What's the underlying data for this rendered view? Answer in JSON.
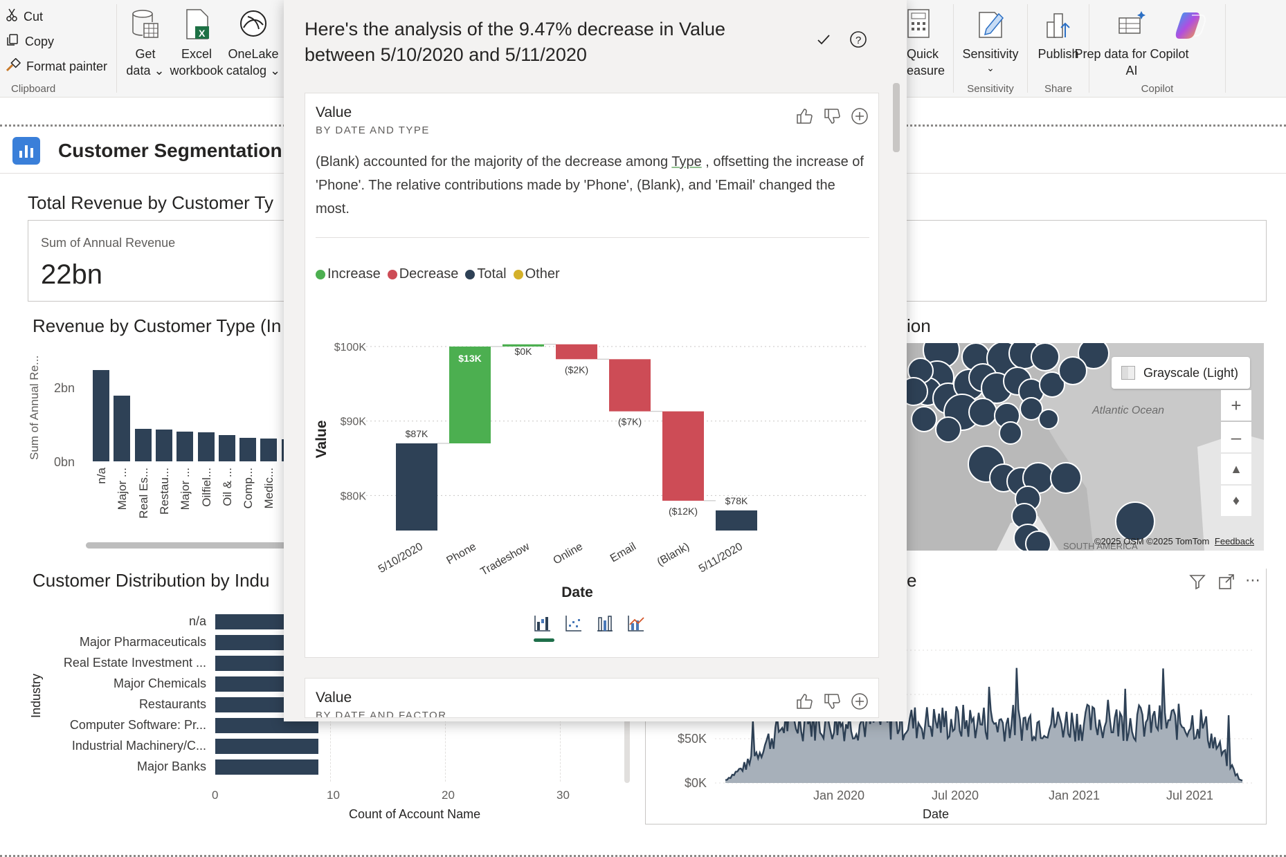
{
  "ribbon": {
    "clipboard": {
      "cut": "Cut",
      "copy": "Copy",
      "format_painter": "Format painter",
      "group": "Clipboard"
    },
    "data": {
      "get_data_1": "Get",
      "get_data_2": "data",
      "excel_1": "Excel",
      "excel_2": "workbook",
      "onelake_1": "OneLake",
      "onelake_2": "catalog"
    },
    "quick_measure_1": "Quick",
    "quick_measure_2": "easure",
    "sensitivity": {
      "label": "Sensitivity",
      "group": "Sensitivity"
    },
    "share": {
      "label": "Publish",
      "group": "Share"
    },
    "copilot": {
      "label_1": "Prep data for Copilot",
      "label_2": "AI",
      "group": "Copilot"
    }
  },
  "report": {
    "title": "Customer Segmentation A",
    "total_revenue_title": "Total Revenue by Customer Ty",
    "card": {
      "label": "Sum of Annual Revenue",
      "value": "22bn"
    },
    "rev_by_type_title": "Revenue by Customer Type (In",
    "rev_by_type": {
      "ylabel": "Sum of Annual Re...",
      "ticks": [
        "2bn",
        "0bn"
      ],
      "categories": [
        "n/a",
        "Major ...",
        "Real Es...",
        "Restau...",
        "Major ...",
        "Oilfiel...",
        "Oil & ...",
        "Comp...",
        "Medic..."
      ],
      "values": [
        2.5,
        1.8,
        0.88,
        0.86,
        0.82,
        0.8,
        0.72,
        0.64,
        0.62,
        0.6
      ]
    },
    "dist_title": "Customer Distribution by Indu",
    "dist": {
      "ylabel": "Industry",
      "xlabel": "Count of Account Name",
      "ticks": [
        "0",
        "10",
        "20",
        "30"
      ],
      "categories": [
        "n/a",
        "Major Pharmaceuticals",
        "Real Estate Investment ...",
        "Major Chemicals",
        "Restaurants",
        "Computer Software: Pr...",
        "Industrial Machinery/C...",
        "Major Banks"
      ],
      "values": [
        9,
        9,
        9,
        9,
        9,
        9,
        9,
        9
      ]
    },
    "map_title_tail": "ion",
    "map": {
      "style": "Grayscale (Light)",
      "ocean": "Atlantic Ocean",
      "attribution": "©2025 OSM ©2025 TomTom",
      "feedback": "Feedback",
      "region": "SOUTH AMERICA"
    },
    "line_title_tail": "e",
    "line": {
      "yticks": [
        "$50K",
        "$0K"
      ],
      "xticks": [
        "Jan 2020",
        "Jul 2020",
        "Jan 2021",
        "Jul 2021"
      ],
      "xlabel": "Date"
    }
  },
  "copilot": {
    "header": "Here's the analysis of the 9.47% decrease in Value between 5/10/2020 and 5/11/2020",
    "card1": {
      "title": "Value",
      "subtitle": "BY DATE AND TYPE",
      "text_a": "(Blank) accounted for the majority of the decrease among ",
      "text_u": "Type",
      "text_b": ", offsetting the increase of 'Phone'. The relative contributions made by 'Phone', (Blank), and 'Email' changed the most."
    },
    "card2": {
      "title": "Value",
      "subtitle": "BY DATE AND FACTOR"
    }
  },
  "chart_data": {
    "type": "bar",
    "subtype": "waterfall",
    "categories": [
      "5/10/2020",
      "Phone",
      "Tradeshow",
      "Online",
      "Email",
      "(Blank)",
      "5/11/2020"
    ],
    "values": [
      87,
      13,
      0.3,
      -2,
      -7,
      -12,
      78
    ],
    "kinds": [
      "total",
      "increase",
      "increase",
      "decrease",
      "decrease",
      "decrease",
      "total"
    ],
    "data_labels": [
      "$87K",
      "$13K",
      "$0K",
      "($2K)",
      "($7K)",
      "($12K)",
      "$78K"
    ],
    "legend": [
      "Increase",
      "Decrease",
      "Total",
      "Other"
    ],
    "colors": {
      "increase": "#4caf50",
      "decrease": "#cd4c56",
      "total": "#2e4156",
      "other": "#d4b12a"
    },
    "yticks": [
      "$100K",
      "$90K",
      "$80K"
    ],
    "ylim": [
      75.3,
      100
    ],
    "xlabel": "Date",
    "ylabel": "Value",
    "legend_position": "top-left"
  }
}
